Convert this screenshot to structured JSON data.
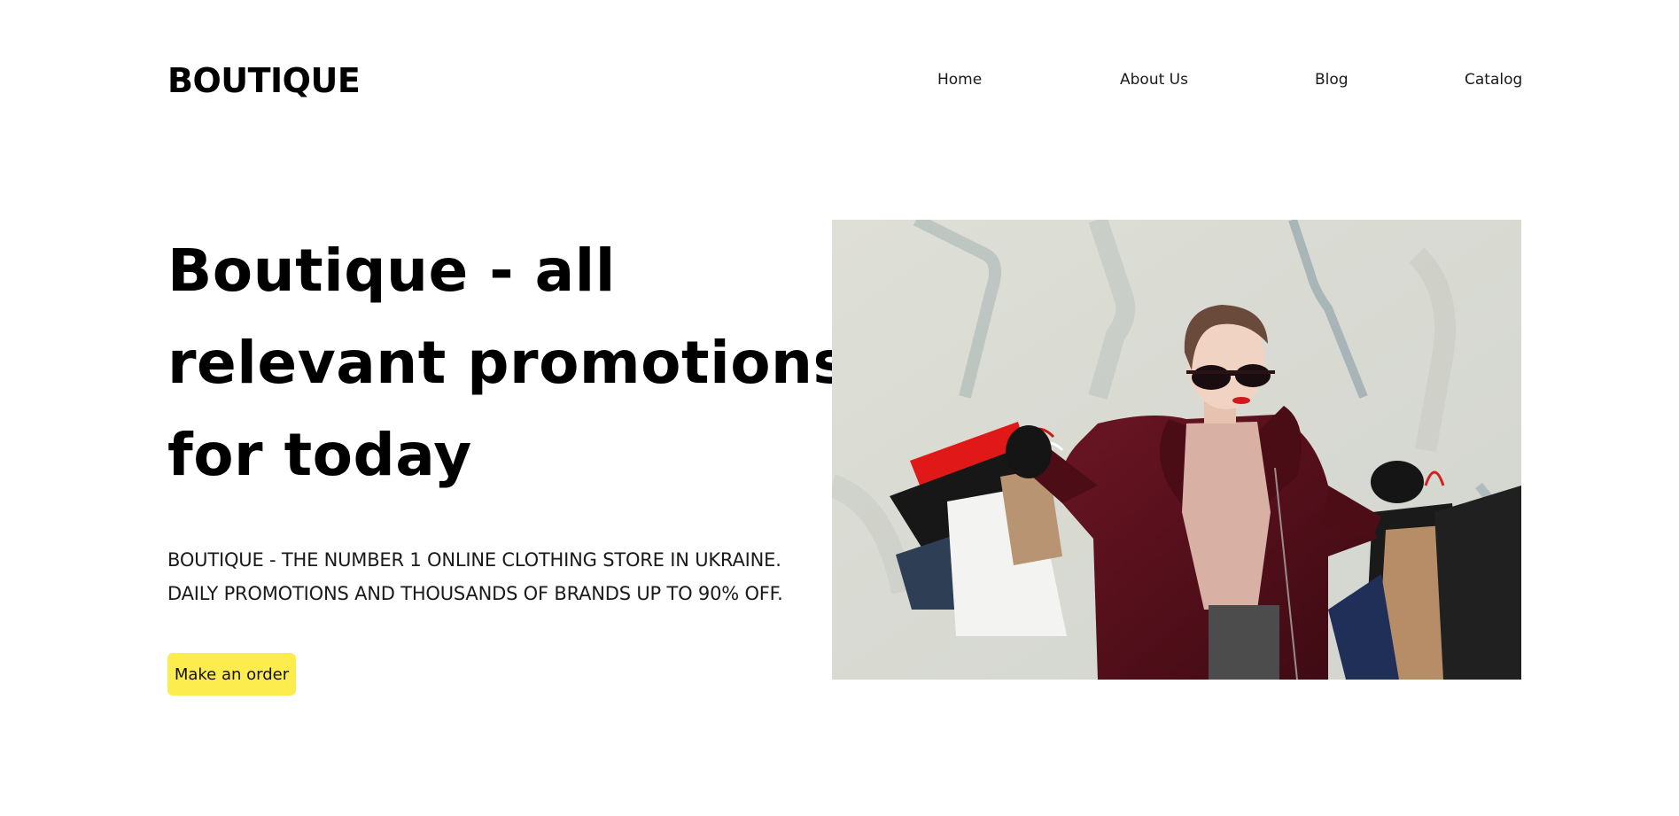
{
  "header": {
    "logo": "BOUTIQUE",
    "nav": [
      {
        "label": "Home"
      },
      {
        "label": "About Us"
      },
      {
        "label": "Blog"
      },
      {
        "label": "Catalog"
      }
    ]
  },
  "hero": {
    "title_lines": [
      "Boutique - all",
      "relevant promotions",
      "for today"
    ],
    "subtitle_lines": [
      "BOUTIQUE - THE NUMBER 1 ONLINE CLOTHING STORE IN UKRAINE.",
      "DAILY PROMOTIONS AND THOUSANDS OF BRANDS UP TO 90% OFF."
    ],
    "cta_label": "Make an order"
  },
  "colors": {
    "background": "#ffffff",
    "text": "#000000",
    "accent": "#fcec4d"
  }
}
